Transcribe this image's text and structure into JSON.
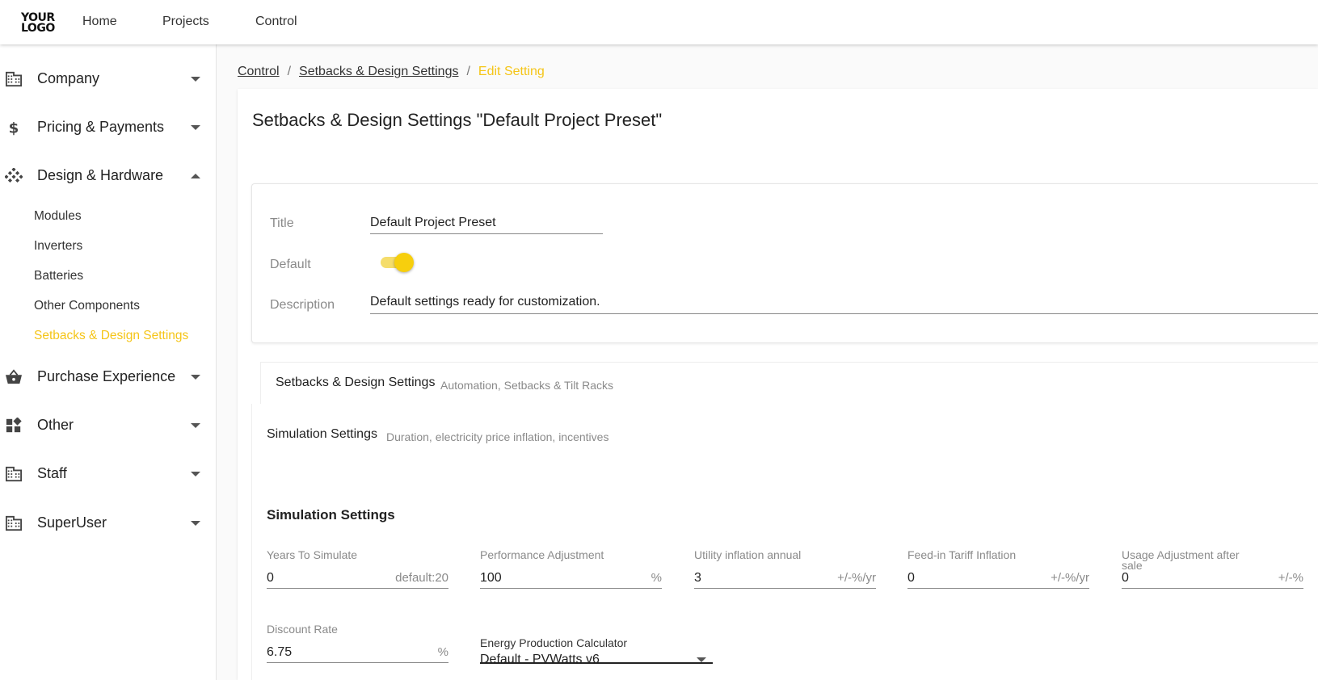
{
  "topbar": {
    "logo_line1": "YOUR",
    "logo_line2": "LOGO",
    "nav": [
      "Home",
      "Projects",
      "Control"
    ]
  },
  "sidebar": {
    "items": [
      {
        "label": "Company",
        "icon": "building-icon",
        "expanded": false
      },
      {
        "label": "Pricing & Payments",
        "icon": "dollar-icon",
        "expanded": false
      },
      {
        "label": "Design & Hardware",
        "icon": "grid-diamond-icon",
        "expanded": true
      },
      {
        "label": "Purchase Experience",
        "icon": "basket-icon",
        "expanded": false
      },
      {
        "label": "Other",
        "icon": "widgets-icon",
        "expanded": false
      },
      {
        "label": "Staff",
        "icon": "building-icon",
        "expanded": false
      },
      {
        "label": "SuperUser",
        "icon": "building-icon",
        "expanded": false
      }
    ],
    "subitems": [
      "Modules",
      "Inverters",
      "Batteries",
      "Other Components",
      "Setbacks & Design Settings"
    ],
    "active_subitem": "Setbacks & Design Settings"
  },
  "breadcrumb": {
    "items": [
      "Control",
      "Setbacks & Design Settings"
    ],
    "separator": "/",
    "current": "Edit Setting"
  },
  "page": {
    "title": "Setbacks & Design Settings \"Default Project Preset\""
  },
  "general": {
    "title_label": "Title",
    "title_value": "Default Project Preset",
    "default_label": "Default",
    "default_on": true,
    "description_label": "Description",
    "description_value": "Default settings ready for customization."
  },
  "tabs": {
    "setbacks_title": "Setbacks & Design Settings",
    "setbacks_sub": "Automation, Setbacks & Tilt Racks",
    "simulation_title": "Simulation Settings",
    "simulation_sub": "Duration, electricity price inflation, incentives"
  },
  "simulation": {
    "heading": "Simulation Settings",
    "fields": [
      {
        "label": "Years To Simulate",
        "value": "0",
        "suffix": "default:20"
      },
      {
        "label": "Performance Adjustment",
        "value": "100",
        "suffix": "%"
      },
      {
        "label": "Utility inflation annual",
        "value": "3",
        "suffix": "+/-%/yr"
      },
      {
        "label": "Feed-in Tariff Inflation",
        "value": "0",
        "suffix": "+/-%/yr"
      },
      {
        "label": "Usage Adjustment after sale",
        "value": "0",
        "suffix": "+/-%"
      },
      {
        "label": "Discount Rate",
        "value": "6.75",
        "suffix": "%"
      }
    ],
    "calculator_label": "Energy Production Calculator",
    "calculator_value": "Default - PVWatts v6"
  },
  "colors": {
    "accent": "#f5c518",
    "toggle_track": "#f5dd6b"
  }
}
